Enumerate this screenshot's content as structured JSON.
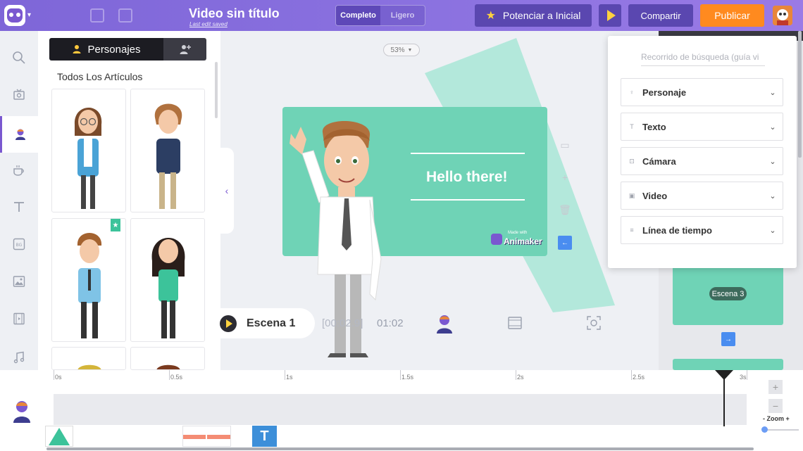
{
  "header": {
    "title": "Video sin título",
    "subtitle": "Last edit saved",
    "mode_options": [
      "Completo",
      "Ligero"
    ],
    "active_mode": "Completo",
    "upgrade_label": "Potenciar a Inicial",
    "share_label": "Compartir",
    "publish_label": "Publicar"
  },
  "library": {
    "active_tab_label": "Personajes",
    "heading": "Todos Los Artículos"
  },
  "canvas": {
    "zoom_level": "53%",
    "scene_text": "Hello there!",
    "watermark_text": "Animaker",
    "watermark_small": "Made with"
  },
  "scene_bar": {
    "scene_name": "Escena 1",
    "current_time": "[00:02.9]",
    "total_time": "01:02"
  },
  "scene_list": {
    "scene_label": "Escena 3"
  },
  "search_popover": {
    "placeholder": "Recorrido de búsqueda (guía vi",
    "sections": [
      {
        "label": "Personaje"
      },
      {
        "label": "Texto"
      },
      {
        "label": "Cámara"
      },
      {
        "label": "Video"
      },
      {
        "label": "Línea de tiempo"
      }
    ]
  },
  "timeline": {
    "ticks": [
      "0s",
      "0.5s",
      "1s",
      "1.5s",
      "2s",
      "2.5s",
      "3s"
    ],
    "zoom_label": "- Zoom +",
    "text_clip_label": "T"
  },
  "colors": {
    "brand_purple": "#7e66d8",
    "scene_green": "#6fd3b6",
    "publish_orange": "#ff8a1f",
    "accent_blue": "#4a8df0"
  }
}
